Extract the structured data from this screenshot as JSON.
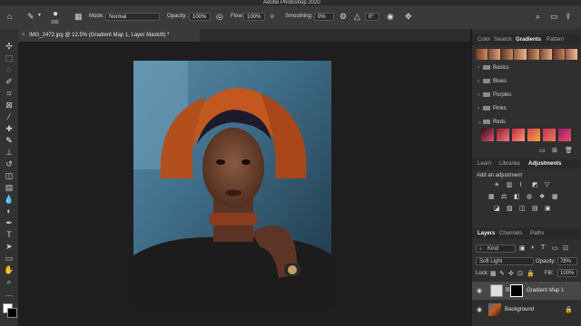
{
  "app": {
    "title": "Adobe Photoshop 2020"
  },
  "options_bar": {
    "brush_size": "200",
    "mode_label": "Mode:",
    "mode_value": "Normal",
    "opacity_label": "Opacity:",
    "opacity_value": "100%",
    "flow_label": "Flow:",
    "flow_value": "100%",
    "smoothing_label": "Smoothing:",
    "smoothing_value": "0%",
    "angle_value": "0°"
  },
  "document": {
    "tab_label": "IMG_2472.jpg @ 12.5% (Gradient Map 1, Layer Mask/8) *",
    "close": "×"
  },
  "tools": [
    "move-tool",
    "marquee-tool",
    "lasso-tool",
    "quick-select-tool",
    "crop-tool",
    "frame-tool",
    "eyedropper-tool",
    "healing-tool",
    "brush-tool",
    "clone-stamp-tool",
    "history-brush-tool",
    "eraser-tool",
    "gradient-tool",
    "blur-tool",
    "dodge-tool",
    "pen-tool",
    "type-tool",
    "path-select-tool",
    "rectangle-tool",
    "hand-tool",
    "zoom-tool"
  ],
  "gradients_panel": {
    "tabs": [
      "Color",
      "Swatch",
      "Gradients",
      "Pattern"
    ],
    "active_tab": "Gradients",
    "folders": [
      "Basics",
      "Blues",
      "Purples",
      "Pinks",
      "Reds"
    ]
  },
  "adjustments_panel": {
    "tabs": [
      "Learn",
      "Libraries",
      "Adjustments"
    ],
    "active_tab": "Adjustments",
    "hint": "Add an adjustment"
  },
  "layers_panel": {
    "tabs": [
      "Layers",
      "Channels",
      "Paths"
    ],
    "active_tab": "Layers",
    "filter_label": "Kind",
    "blend_mode": "Soft Light",
    "opacity_label": "Opacity:",
    "opacity_value": "78%",
    "lock_label": "Lock:",
    "fill_label": "Fill:",
    "fill_value": "100%",
    "layers": [
      {
        "name": "Gradient Map 1"
      },
      {
        "name": "Background"
      }
    ]
  },
  "colors": {
    "accent": "#3a7bd5",
    "panel_bg": "#2f2f2f",
    "canvas_bg": "#1e1e1e"
  }
}
